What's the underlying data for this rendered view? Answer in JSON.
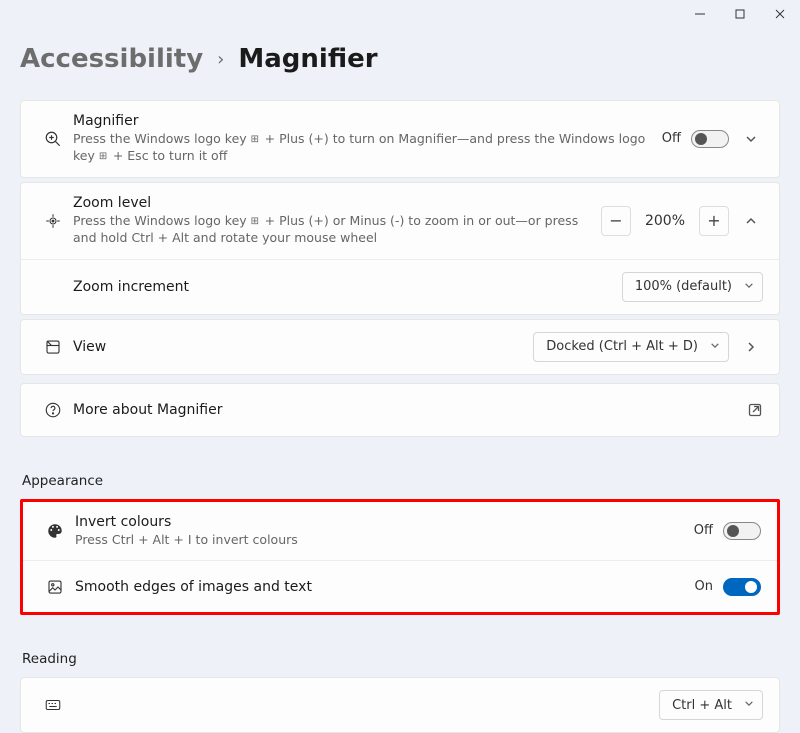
{
  "breadcrumb": {
    "parent": "Accessibility",
    "current": "Magnifier"
  },
  "rows": {
    "magnifier": {
      "title": "Magnifier",
      "subtitle_pre": "Press the Windows logo key ",
      "subtitle_mid": " + Plus (+) to turn on Magnifier—and press the Windows logo key ",
      "subtitle_post": " + Esc to turn it off",
      "state": "Off"
    },
    "zoom_level": {
      "title": "Zoom level",
      "subtitle_pre": "Press the Windows logo key ",
      "subtitle_post": " + Plus (+) or Minus (-) to zoom in or out—or press and hold Ctrl + Alt and rotate your mouse wheel",
      "value": "200%"
    },
    "zoom_increment": {
      "title": "Zoom increment",
      "value": "100% (default)"
    },
    "view": {
      "title": "View",
      "value": "Docked (Ctrl + Alt + D)"
    },
    "more": {
      "title": "More about Magnifier"
    }
  },
  "sections": {
    "appearance": "Appearance",
    "reading": "Reading"
  },
  "appearance": {
    "invert": {
      "title": "Invert colours",
      "subtitle": "Press Ctrl + Alt + I to invert colours",
      "state": "Off"
    },
    "smooth": {
      "title": "Smooth edges of images and text",
      "state": "On"
    }
  },
  "reading_row": {
    "dropdown_hint": "Ctrl + Alt"
  }
}
